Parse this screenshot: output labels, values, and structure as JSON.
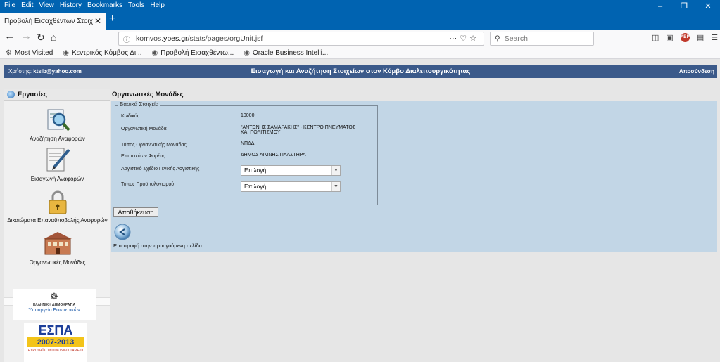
{
  "browser": {
    "menu": [
      "File",
      "Edit",
      "View",
      "History",
      "Bookmarks",
      "Tools",
      "Help"
    ],
    "tab_title": "Προβολή Εισαχθέντων Στοιχείων",
    "url_prefix": "komvos.",
    "url_host": "ypes.gr",
    "url_path": "/stats/pages/orgUnit.jsf",
    "search_placeholder": "Search",
    "bookmarks": [
      "Most Visited",
      "Κεντρικός Κόμβος Δι...",
      "Προβολή Εισαχθέντω...",
      "Oracle Business Intelli..."
    ]
  },
  "header": {
    "user_label": "Χρήστης:",
    "user_email": "ktsib@yahoo.com",
    "title": "Εισαγωγή και Αναζήτηση Στοιχείων στον Κόμβο Διαλειτουργικότητας",
    "logout": "Αποσύνδεση"
  },
  "sidebar": {
    "heading": "Εργασίες",
    "items": [
      {
        "label": "Αναζήτηση Αναφορών",
        "icon": "search-reports-icon"
      },
      {
        "label": "Εισαγωγή Αναφορών",
        "icon": "edit-document-icon"
      },
      {
        "label": "Δικαιώματα Επαναϋποβολής Αναφορών",
        "icon": "padlock-icon"
      },
      {
        "label": "Οργανωτικές Μονάδες",
        "icon": "building-icon"
      }
    ],
    "gov_logo": {
      "line1": "ΕΛΛΗΝΙΚΗ ΔΗΜΟΚΡΑΤΙΑ",
      "line2": "Υπουργείο Εσωτερικών"
    },
    "espa": {
      "title": "ΕΣΠΑ",
      "years": "2007-2013",
      "tagline": "ΕΥΡΩΠΑΪΚΟ ΚΟΙΝΩΝΙΚΟ ΤΑΜΕΙΟ"
    }
  },
  "main": {
    "title": "Οργανωτικές Μονάδες",
    "legend": "Βασικά Στοιχεία",
    "fields": [
      {
        "label": "Κωδικός",
        "value": "10000"
      },
      {
        "label": "Οργανωτική Μονάδα",
        "value": "\"ΑΝΤΩΝΗΣ ΣΑΜΑΡΑΚΗΣ\" - ΚΕΝΤΡΟ ΠΝΕΥΜΑΤΟΣ ΚΑΙ ΠΟΛΙΤΙΣΜΟΥ"
      },
      {
        "label": "Τύπος Οργανωτικής Μονάδας",
        "value": "ΝΠΔΔ"
      },
      {
        "label": "Εποπτεύων Φορέας",
        "value": "ΔΗΜΟΣ ΛΙΜΝΗΣ ΠΛΑΣΤΗΡΑ"
      }
    ],
    "selects": [
      {
        "label": "Λογιστικό Σχέδιο Γενικής Λογιστικής",
        "value": "Επιλογή"
      },
      {
        "label": "Τύπος Προϋπολογισμού",
        "value": "Επιλογή"
      }
    ],
    "save_button": "Αποθήκευση",
    "back_text": "Επιστροφή στην προηγούμενη σελίδα"
  }
}
